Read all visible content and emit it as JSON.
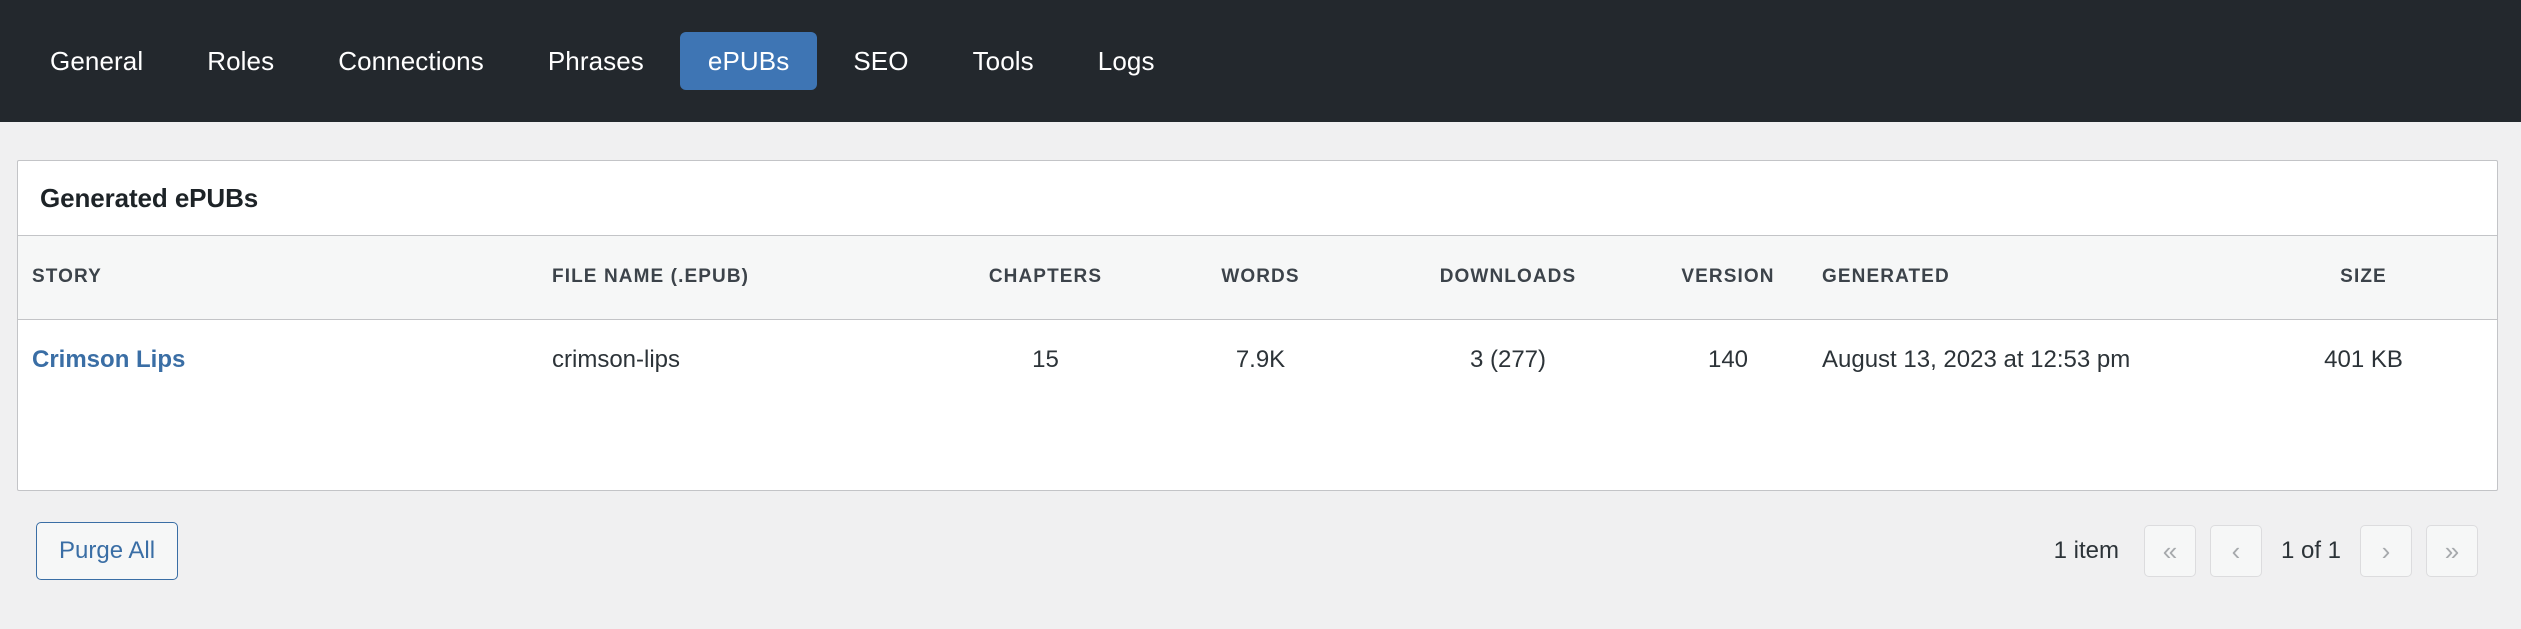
{
  "nav": {
    "tabs": [
      {
        "label": "General",
        "active": false
      },
      {
        "label": "Roles",
        "active": false
      },
      {
        "label": "Connections",
        "active": false
      },
      {
        "label": "Phrases",
        "active": false
      },
      {
        "label": "ePUBs",
        "active": true
      },
      {
        "label": "SEO",
        "active": false
      },
      {
        "label": "Tools",
        "active": false
      },
      {
        "label": "Logs",
        "active": false
      }
    ],
    "active_tab": "ePUBs",
    "background_color": "#23282d",
    "active_color": "#3e75b4"
  },
  "card": {
    "title": "Generated ePUBs"
  },
  "table": {
    "columns": [
      "STORY",
      "FILE NAME (.EPUB)",
      "CHAPTERS",
      "WORDS",
      "DOWNLOADS",
      "VERSION",
      "GENERATED",
      "SIZE"
    ],
    "rows": [
      {
        "story": "Crimson Lips",
        "file_name": "crimson-lips",
        "chapters": "15",
        "words": "7.9K",
        "downloads": "3 (277)",
        "version": "140",
        "generated": "August 13, 2023 at 12:53 pm",
        "size": "401 KB"
      }
    ]
  },
  "footer": {
    "purge_label": "Purge All",
    "item_count": "1 item",
    "page_label": "1 of 1",
    "first_page_glyph": "«",
    "prev_page_glyph": "‹",
    "next_page_glyph": "›",
    "last_page_glyph": "»"
  },
  "colors": {
    "link": "#3a6ea5",
    "accent": "#3e75b4",
    "page_background": "#f0f0f1",
    "card_border": "#c3c4c7",
    "table_header_background": "#f6f7f7"
  }
}
